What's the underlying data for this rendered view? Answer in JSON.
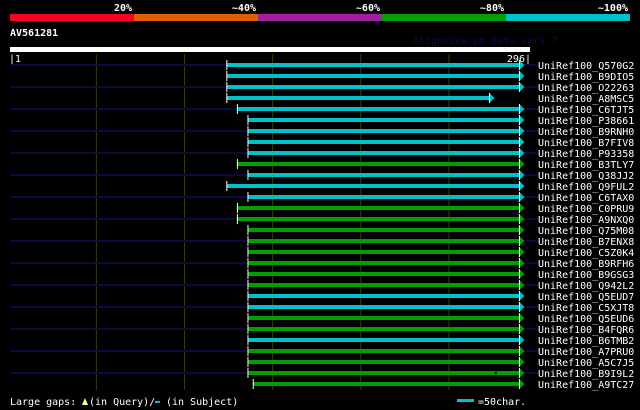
{
  "identity_scale": [
    {
      "label": "20%",
      "color": "#ff0022"
    },
    {
      "label": "~40%",
      "color": "#e06000"
    },
    {
      "label": "~60%",
      "color": "#a020a0"
    },
    {
      "label": "~80%",
      "color": "#00a000"
    },
    {
      "label": "~100%",
      "color": "#00c0c8"
    }
  ],
  "query": {
    "name": "AV561281",
    "start_label": "|1",
    "end_label": "296|",
    "length": 296
  },
  "watermark": "AlignView.pm Beta ver1.7",
  "colors": {
    "navy": "#0a0a40",
    "grid": "#3a3a10",
    "green": "#00a000",
    "cyan": "#00c0c8",
    "gap_query": "#ffff99"
  },
  "hits": [
    {
      "id": "UniRef100_Q570G2",
      "start": 124,
      "end": 290,
      "color": "cyan"
    },
    {
      "id": "UniRef100_B9DIO5",
      "start": 124,
      "end": 290,
      "color": "cyan"
    },
    {
      "id": "UniRef100_O22263",
      "start": 124,
      "end": 290,
      "color": "cyan"
    },
    {
      "id": "UniRef100_A8MSC5",
      "start": 124,
      "end": 273,
      "color": "cyan"
    },
    {
      "id": "UniRef100_C6TJT5",
      "start": 130,
      "end": 290,
      "color": "cyan"
    },
    {
      "id": "UniRef100_P38661",
      "start": 136,
      "end": 290,
      "color": "cyan"
    },
    {
      "id": "UniRef100_B9RNH0",
      "start": 136,
      "end": 290,
      "color": "cyan"
    },
    {
      "id": "UniRef100_B7FIV8",
      "start": 136,
      "end": 290,
      "color": "cyan"
    },
    {
      "id": "UniRef100_P93358",
      "start": 136,
      "end": 290,
      "color": "cyan"
    },
    {
      "id": "UniRef100_B3TLY7",
      "start": 130,
      "end": 290,
      "color": "green"
    },
    {
      "id": "UniRef100_Q38JJ2",
      "start": 136,
      "end": 290,
      "color": "cyan"
    },
    {
      "id": "UniRef100_Q9FUL2",
      "start": 124,
      "end": 290,
      "color": "cyan"
    },
    {
      "id": "UniRef100_C6TAX0",
      "start": 136,
      "end": 290,
      "color": "cyan"
    },
    {
      "id": "UniRef100_C0PRU9",
      "start": 130,
      "end": 290,
      "color": "green"
    },
    {
      "id": "UniRef100_A9NXQ0",
      "start": 130,
      "end": 290,
      "color": "green"
    },
    {
      "id": "UniRef100_Q75M08",
      "start": 136,
      "end": 290,
      "color": "green"
    },
    {
      "id": "UniRef100_B7ENX8",
      "start": 136,
      "end": 290,
      "color": "green"
    },
    {
      "id": "UniRef100_C5Z0K4",
      "start": 136,
      "end": 290,
      "color": "green"
    },
    {
      "id": "UniRef100_B9RFH6",
      "start": 136,
      "end": 290,
      "color": "green"
    },
    {
      "id": "UniRef100_B9GSG3",
      "start": 136,
      "end": 290,
      "color": "green"
    },
    {
      "id": "UniRef100_Q942L2",
      "start": 136,
      "end": 290,
      "color": "green"
    },
    {
      "id": "UniRef100_Q5EUD7",
      "start": 136,
      "end": 290,
      "color": "cyan"
    },
    {
      "id": "UniRef100_C5XJT8",
      "start": 136,
      "end": 290,
      "color": "cyan"
    },
    {
      "id": "UniRef100_Q5EUD6",
      "start": 136,
      "end": 290,
      "color": "green"
    },
    {
      "id": "UniRef100_B4FQR6",
      "start": 136,
      "end": 290,
      "color": "green"
    },
    {
      "id": "UniRef100_B6TMB2",
      "start": 136,
      "end": 290,
      "color": "cyan"
    },
    {
      "id": "UniRef100_A7PRU0",
      "start": 136,
      "end": 290,
      "color": "green"
    },
    {
      "id": "UniRef100_A5C7J5",
      "start": 136,
      "end": 290,
      "color": "green"
    },
    {
      "id": "UniRef100_B9I9L2",
      "start": 136,
      "end": 290,
      "color": "green",
      "subject_gap_at": 276
    },
    {
      "id": "UniRef100_A9TC27",
      "start": 139,
      "end": 290,
      "color": "green"
    }
  ],
  "legend": {
    "gaps_label": "Large gaps:",
    "query_gap": "(in Query)/",
    "subject_gap": "(in Subject)",
    "scale_label": "=50char."
  }
}
